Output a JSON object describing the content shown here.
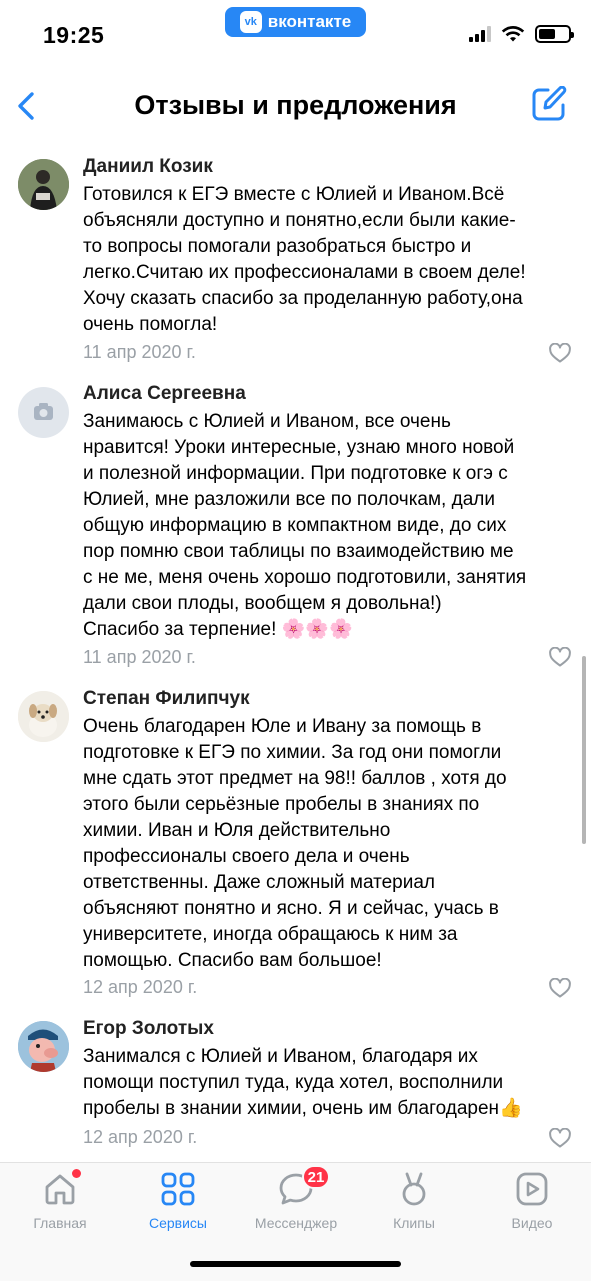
{
  "status_bar": {
    "time": "19:25",
    "app_pill": "вконтакте",
    "app_logo": "vk"
  },
  "header": {
    "title": "Отзывы и предложения",
    "back_icon": "chevron-left-icon",
    "compose_icon": "edit-icon"
  },
  "accent": "#2787f5",
  "comments": [
    {
      "author": "Даниил Козик",
      "text": "Готовился к ЕГЭ вместе с Юлией и Иваном.Всё\nобъясняли доступно и понятно,если были какие-\nто вопросы помогали разобраться быстро и\nлегко.Считаю их профессионалами в своем деле!\nХочу сказать спасибо за проделанную работу,она\nочень помогла!",
      "date": "11 апр 2020 г."
    },
    {
      "author": "Алиса Сергеевна",
      "text": "Занимаюсь с Юлией и Иваном, все очень\nнравится! Уроки интересные, узнаю много новой\nи полезной информации. При подготовке к огэ с\nЮлией, мне  разложили все по полочкам, дали\nобщую информацию в компактном виде, до сих\nпор помню свои таблицы по взаимодействию ме\nс не ме, меня очень хорошо подготовили, занятия\nдали свои плоды, вообщем я довольна!)\nСпасибо за терпение! 🌸🌸🌸",
      "date": "11 апр 2020 г."
    },
    {
      "author": "Степан Филипчук",
      "text": "Очень благодарен Юле и Ивану за помощь в\nподготовке к ЕГЭ по химии. За год они помогли\nмне сдать этот предмет на 98!! баллов , хотя до\nэтого были серьёзные пробелы в знаниях по\nхимии. Иван и Юля действительно\nпрофессионалы своего дела и очень\nответственны. Даже сложный материал\nобъясняют понятно и ясно. Я и сейчас, учась в\nуниверситете, иногда обращаюсь к ним за\nпомощью. Спасибо вам большое!",
      "date": "12 апр 2020 г."
    },
    {
      "author": "Егор Золотых",
      "text": "Занимался с Юлией и Иваном, благодаря их\nпомощи поступил туда, куда хотел, восполнили\nпробелы в знании химии, очень им благодарен👍",
      "date": "12 апр 2020 г."
    }
  ],
  "tabbar": {
    "tabs": [
      {
        "label": "Главная",
        "icon": "home-icon",
        "has_dot": true
      },
      {
        "label": "Сервисы",
        "icon": "services-icon",
        "active": true
      },
      {
        "label": "Мессенджер",
        "icon": "messenger-icon",
        "badge": "21"
      },
      {
        "label": "Клипы",
        "icon": "clips-icon"
      },
      {
        "label": "Видео",
        "icon": "video-icon"
      }
    ]
  }
}
